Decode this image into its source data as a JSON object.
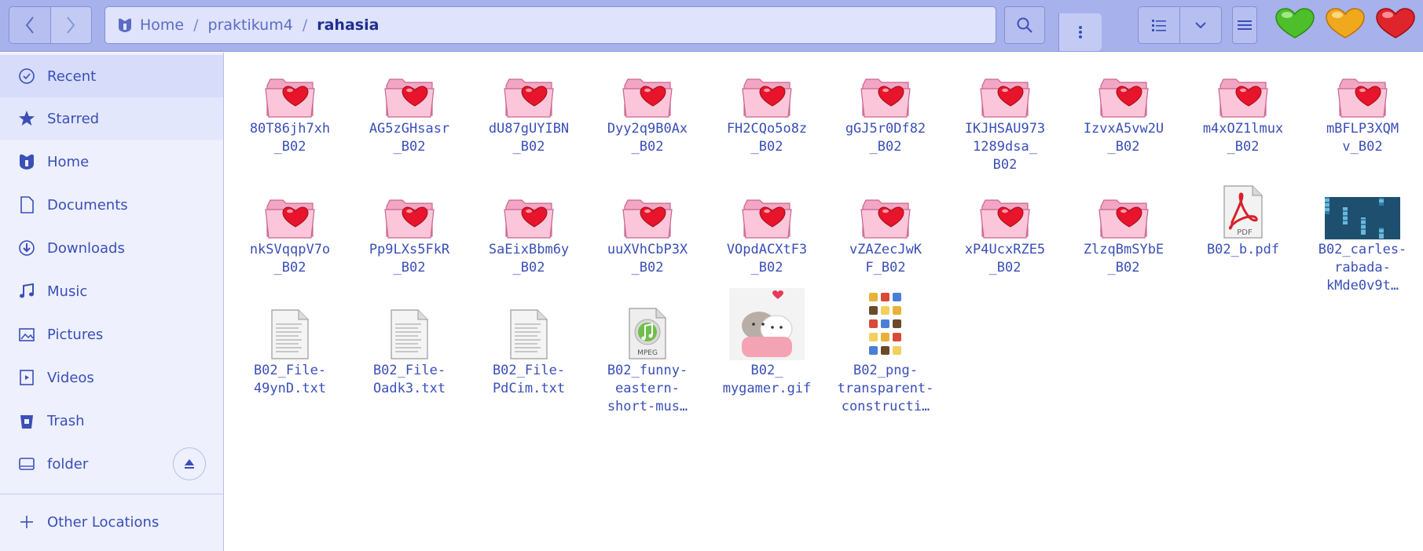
{
  "header": {
    "back_icon": "chevron-left-icon",
    "forward_icon": "chevron-right-icon",
    "breadcrumb": [
      {
        "label": "Home",
        "icon": "home-icon"
      },
      {
        "label": "praktikum4"
      },
      {
        "label": "rahasia"
      }
    ],
    "separator": "/",
    "menu_icon": "vertical-dots-icon",
    "search_icon": "search-icon",
    "view_list_icon": "list-view-icon",
    "view_dropdown_icon": "chevron-down-icon",
    "hamburger_icon": "hamburger-menu-icon",
    "window_controls": [
      {
        "name": "minimize",
        "color": "#4cbf2a"
      },
      {
        "name": "maximize",
        "color": "#f0a81c"
      },
      {
        "name": "close",
        "color": "#e0242c"
      }
    ]
  },
  "sidebar": {
    "items": [
      {
        "label": "Recent",
        "icon": "clock-icon"
      },
      {
        "label": "Starred",
        "icon": "star-icon"
      },
      {
        "label": "Home",
        "icon": "home-icon"
      },
      {
        "label": "Documents",
        "icon": "document-icon"
      },
      {
        "label": "Downloads",
        "icon": "download-icon"
      },
      {
        "label": "Music",
        "icon": "music-icon"
      },
      {
        "label": "Pictures",
        "icon": "pictures-icon"
      },
      {
        "label": "Videos",
        "icon": "film-icon"
      },
      {
        "label": "Trash",
        "icon": "trash-icon"
      },
      {
        "label": "folder",
        "icon": "drive-icon"
      }
    ],
    "other_locations": {
      "label": "Other Locations",
      "icon": "plus-icon"
    },
    "eject_icon": "eject-icon"
  },
  "files": [
    {
      "name": "80T86jh7xh\n_B02",
      "type": "folder"
    },
    {
      "name": "AG5zGHsasr\n_B02",
      "type": "folder"
    },
    {
      "name": "dU87gUYIBN\n_B02",
      "type": "folder"
    },
    {
      "name": "Dyy2q9B0Ax\n_B02",
      "type": "folder"
    },
    {
      "name": "FH2CQo5o8z\n_B02",
      "type": "folder"
    },
    {
      "name": "gGJ5r0Df82\n_B02",
      "type": "folder"
    },
    {
      "name": "IKJHSAU973\n1289dsa_\nB02",
      "type": "folder"
    },
    {
      "name": "IzvxA5vw2U\n_B02",
      "type": "folder"
    },
    {
      "name": "m4xOZ1lmux\n_B02",
      "type": "folder"
    },
    {
      "name": "mBFLP3XQM\nv_B02",
      "type": "folder"
    },
    {
      "name": "nkSVqqpV7o\n_B02",
      "type": "folder"
    },
    {
      "name": "Pp9LXs5FkR\n_B02",
      "type": "folder"
    },
    {
      "name": "SaEixBbm6y\n_B02",
      "type": "folder"
    },
    {
      "name": "uuXVhCbP3X\n_B02",
      "type": "folder"
    },
    {
      "name": "VOpdACXtF3\n_B02",
      "type": "folder"
    },
    {
      "name": "vZAZecJwK\nF_B02",
      "type": "folder"
    },
    {
      "name": "xP4UcxRZE5\n_B02",
      "type": "folder"
    },
    {
      "name": "ZlzqBmSYbE\n_B02",
      "type": "folder"
    },
    {
      "name": "B02_b.pdf",
      "type": "pdf",
      "badge": "PDF"
    },
    {
      "name": "B02_carles-\nrabada-\nkMde0v9t…",
      "type": "image-photo"
    },
    {
      "name": "B02_File-\n49ynD.txt",
      "type": "text"
    },
    {
      "name": "B02_File-\nOadk3.txt",
      "type": "text"
    },
    {
      "name": "B02_File-\nPdCim.txt",
      "type": "text"
    },
    {
      "name": "B02_funny-\neastern-\nshort-mus…",
      "type": "audio",
      "badge": "MPEG"
    },
    {
      "name": "B02_\nmygamer.gif",
      "type": "image-gif"
    },
    {
      "name": "B02_png-\ntransparent-\nconstructi…",
      "type": "image-png"
    }
  ]
}
